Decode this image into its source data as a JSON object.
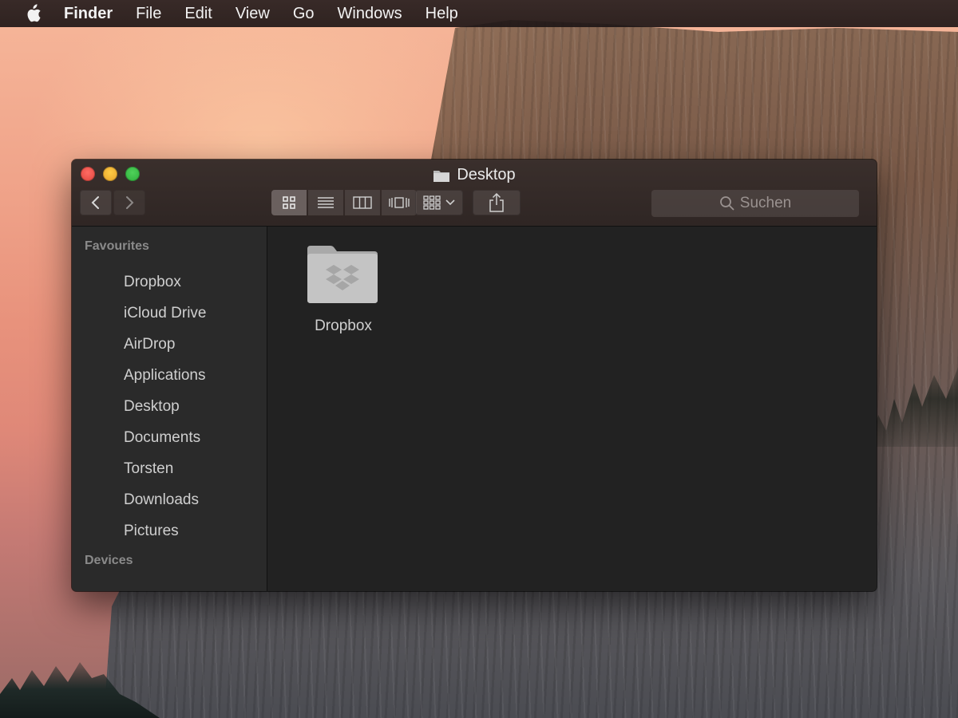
{
  "menubar": {
    "apple_icon": "apple-logo-icon",
    "items": [
      "Finder",
      "File",
      "Edit",
      "View",
      "Go",
      "Windows",
      "Help"
    ]
  },
  "window": {
    "title": "Desktop",
    "toolbar": {
      "back_icon": "chevron-left-icon",
      "forward_icon": "chevron-right-icon",
      "view_modes": [
        "icon-view",
        "list-view",
        "column-view",
        "cover-flow-view"
      ],
      "arrange_icon": "grid-arrange-icon",
      "share_icon": "share-icon",
      "search_placeholder": "Suchen"
    },
    "sidebar": {
      "favourites_heading": "Favourites",
      "items": [
        "Dropbox",
        "iCloud Drive",
        "AirDrop",
        "Applications",
        "Desktop",
        "Documents",
        "Torsten",
        "Downloads",
        "Pictures"
      ],
      "devices_heading": "Devices"
    },
    "content": {
      "files": [
        {
          "name": "Dropbox",
          "icon": "dropbox-folder-icon"
        }
      ]
    }
  },
  "colors": {
    "close": "#e0443c",
    "minimize": "#e6a12a",
    "maximize": "#2eae3a",
    "sidebar_bg": "#2a2a2a",
    "content_bg": "#222222"
  }
}
